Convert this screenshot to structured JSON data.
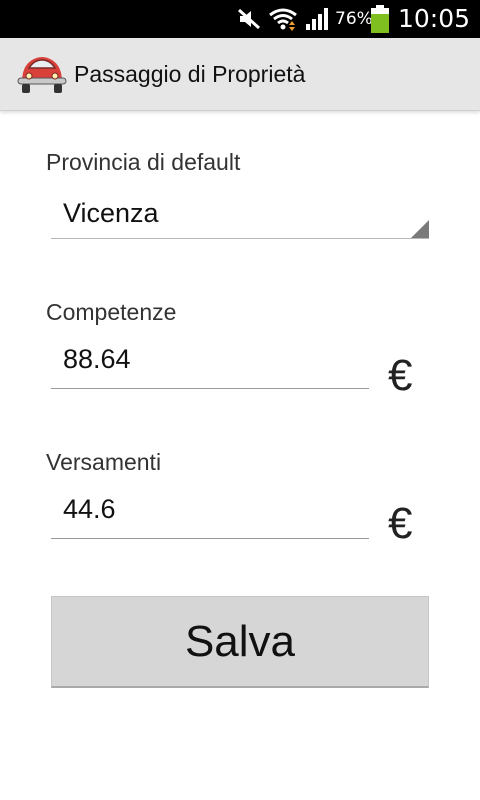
{
  "status_bar": {
    "battery_percent": "76%",
    "time": "10:05",
    "icons": [
      "mute-icon",
      "wifi-icon",
      "signal-icon",
      "battery-icon"
    ]
  },
  "action_bar": {
    "title": "Passaggio di Proprietà",
    "icon": "car-icon"
  },
  "form": {
    "provincia_label": "Provincia di default",
    "provincia_value": "Vicenza",
    "competenze_label": "Competenze",
    "competenze_value": "88.64",
    "versamenti_label": "Versamenti",
    "versamenti_value": "44.6",
    "currency_symbol": "€"
  },
  "actions": {
    "save_label": "Salva"
  },
  "colors": {
    "action_bar_bg": "#e6e6e6",
    "button_bg": "#d6d6d6",
    "car_red": "#d9403a"
  }
}
